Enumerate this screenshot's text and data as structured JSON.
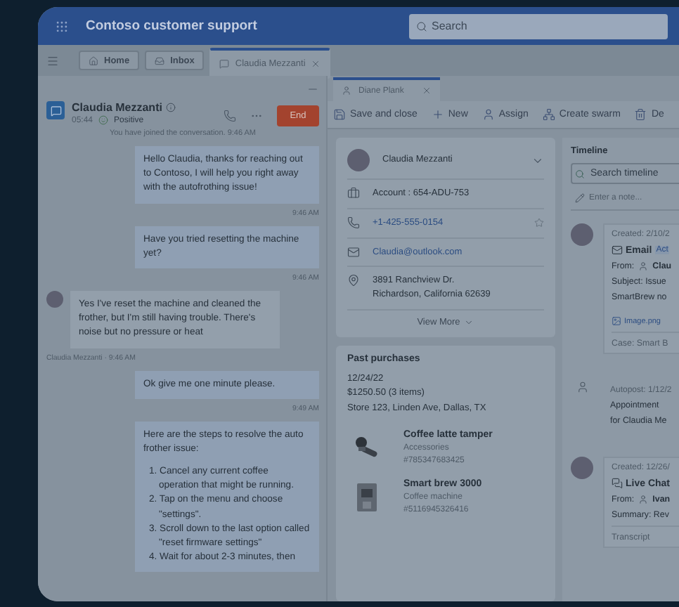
{
  "app": {
    "title": "Contoso customer support",
    "search": {
      "placeholder": "Search"
    }
  },
  "tabs": [
    {
      "label": "Home",
      "kind": "home",
      "selected": false
    },
    {
      "label": "Inbox",
      "kind": "inbox",
      "selected": false
    },
    {
      "label": "Claudia Mezzanti",
      "kind": "chat",
      "selected": true
    }
  ],
  "conversation": {
    "name": "Claudia Mezzanti",
    "time": "05:44",
    "sentiment": "Positive",
    "end_button": "End",
    "system_note": "You have joined the conversation. 9:46 AM",
    "messages": [
      {
        "kind": "agent",
        "text": "Hello Claudia, thanks for reaching out to Contoso, I will help you right away with the autofrothing issue!",
        "meta": "9:46 AM"
      },
      {
        "kind": "agent",
        "text": "Have you tried resetting the machine yet?",
        "meta": "9:46 AM"
      },
      {
        "kind": "customer",
        "text": "Yes I've reset the machine and cleaned the frother, but I'm still having trouble. There's noise but no pressure or heat",
        "meta": "Claudia Mezzanti · 9:46 AM"
      },
      {
        "kind": "agent",
        "text": "Ok give me one minute please.",
        "meta": "9:49 AM"
      },
      {
        "kind": "agent",
        "text": "Here are the steps to resolve the auto frother issue:",
        "steps": [
          "1. Cancel any current coffee operation that might be running.",
          "2. Tap on the menu and choose \"settings\".",
          "3. Scroll down to the last option called \"reset firmware settings\"",
          "4. Wait for about 2-3 minutes, then"
        ]
      }
    ]
  },
  "record_tab": {
    "label": "Diane Plank",
    "selected": true
  },
  "commands": [
    {
      "label": "Save and close",
      "kind": "save"
    },
    {
      "label": "New",
      "kind": "new"
    },
    {
      "label": "Assign",
      "kind": "assign"
    },
    {
      "label": "Create swarm",
      "kind": "swarm"
    },
    {
      "label": "De",
      "kind": "delete"
    }
  ],
  "contact": {
    "name": "Claudia Mezzanti",
    "fields": [
      {
        "kind": "account",
        "lines": [
          "Account : 654-ADU-753"
        ]
      },
      {
        "kind": "phone",
        "lines": [
          "+1-425-555-0154"
        ]
      },
      {
        "kind": "email",
        "lines": [
          "Claudia@outlook.com"
        ]
      },
      {
        "kind": "address",
        "lines": [
          "3891 Ranchview Dr.",
          "Richardson, California 62639"
        ]
      }
    ],
    "view_more": "View More"
  },
  "purchases": {
    "title": "Past purchases",
    "date": "12/24/22",
    "total": "$1250.50 (3 items)",
    "store": "Store 123, Linden Ave, Dallas, TX",
    "items": [
      {
        "kind": "tamper",
        "name": "Coffee latte tamper",
        "category": "Accessories",
        "sku": "#785347683425"
      },
      {
        "kind": "machine",
        "name": "Smart brew 3000",
        "category": "Coffee machine",
        "sku": "#5116945326416"
      }
    ]
  },
  "timeline": {
    "title": "Timeline",
    "search": {
      "placeholder": "Search timeline"
    },
    "note": {
      "placeholder": "Enter a note..."
    },
    "entries": [
      {
        "kind": "email",
        "meta": "Created: 2/10/2",
        "type": "Email",
        "badge": "Act",
        "from_label": "From:",
        "from": "Clau",
        "lines": [
          "Subject: Issue",
          "SmartBrew no"
        ],
        "attachment": "Image.png",
        "footer": "Case: Smart B"
      },
      {
        "kind": "autopost",
        "meta": "Autopost: 1/12/2",
        "lines": [
          "Appointment",
          "for Claudia Me"
        ]
      },
      {
        "kind": "chat",
        "meta": "Created: 12/26/",
        "type": "Live Chat",
        "from_label": "From:",
        "from": "Ivan",
        "lines": [
          "Summary: Rev"
        ],
        "footer": "Transcript"
      }
    ]
  }
}
